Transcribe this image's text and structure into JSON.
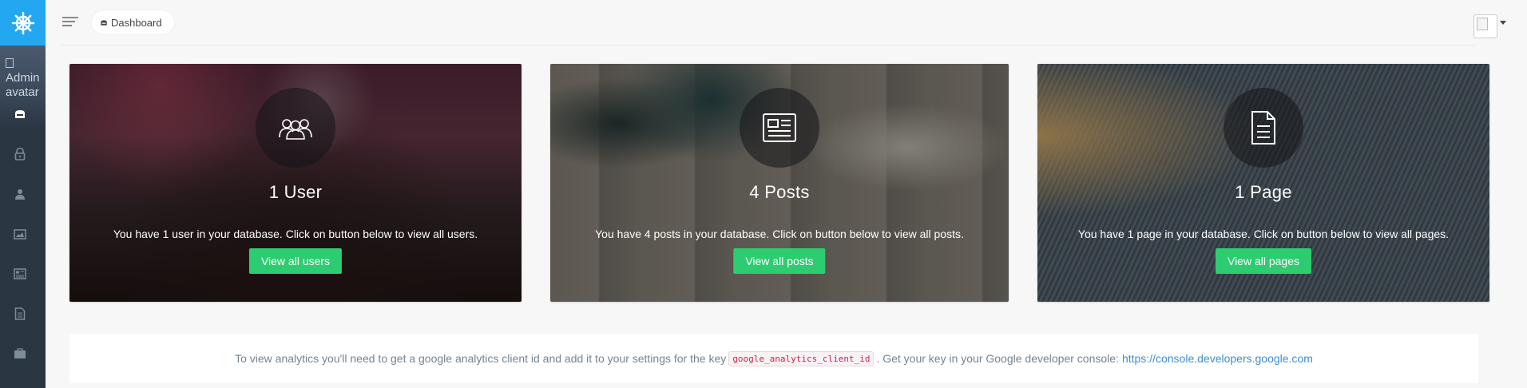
{
  "sidebar": {
    "logo_icon": "ship-wheel-icon",
    "avatar_alt": "Admin avatar",
    "items": [
      {
        "icon": "dashboard-icon"
      },
      {
        "icon": "lock-icon"
      },
      {
        "icon": "user-icon"
      },
      {
        "icon": "image-icon"
      },
      {
        "icon": "news-icon"
      },
      {
        "icon": "document-icon"
      },
      {
        "icon": "briefcase-icon"
      }
    ]
  },
  "header": {
    "breadcrumb": "Dashboard"
  },
  "cards": [
    {
      "title": "1 User",
      "description": "You have 1 user in your database. Click on button below to view all users.",
      "button": "View all users"
    },
    {
      "title": "4 Posts",
      "description": "You have 4 posts in your database. Click on button below to view all posts.",
      "button": "View all posts"
    },
    {
      "title": "1 Page",
      "description": "You have 1 page in your database. Click on button below to view all pages.",
      "button": "View all pages"
    }
  ],
  "analytics": {
    "text_before": "To view analytics you'll need to get a google analytics client id and add it to your settings for the key",
    "key": "google_analytics_client_id",
    "text_after": ". Get your key in your Google developer console:",
    "link": "https://console.developers.google.com"
  },
  "colors": {
    "accent": "#22a7f0",
    "sidebar": "#2b3643",
    "button": "#2ecc71"
  }
}
